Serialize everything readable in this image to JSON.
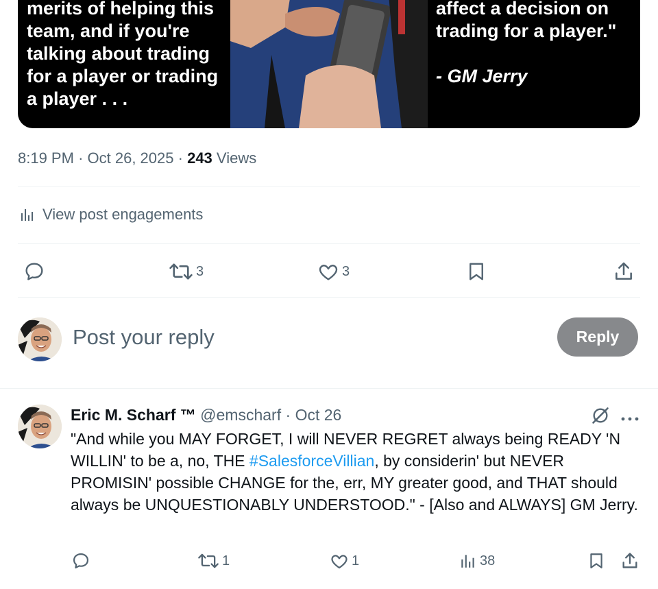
{
  "media": {
    "left_lines": [
      "merits of helping this",
      "team, and if you're",
      "talking about trading",
      "for a player or trading",
      "a player . . ."
    ],
    "right_lines": [
      "affect a decision on",
      "trading for a player.\""
    ],
    "signature": "- GM Jerry"
  },
  "meta": {
    "time": "8:19 PM",
    "date": "Oct 26, 2025",
    "views_count": "243",
    "views_label": "Views"
  },
  "engagements_label": "View post engagements",
  "actions": {
    "retweets": "3",
    "likes": "3"
  },
  "composer": {
    "placeholder": "Post your reply",
    "reply_button": "Reply"
  },
  "reply": {
    "name": "Eric M. Scharf ™",
    "handle": "@emscharf",
    "date": "Oct 26",
    "text_before": "\"And while you MAY FORGET, I will NEVER REGRET always being READY 'N WILLIN' to be a, no, THE ",
    "hashtag": "#SalesforceVillian",
    "text_after": ", by considerin' but NEVER PROMISIN' possible CHANGE for the, err, MY greater good, and THAT should always be UNQUESTIONABLY UNDERSTOOD.\" - [Also and ALWAYS] GM Jerry.",
    "retweets": "1",
    "likes": "1",
    "views": "38"
  },
  "colors": {
    "text_primary": "#0f1419",
    "text_secondary": "#536471",
    "link": "#1d9bf0",
    "reply_button_disabled": "#87898c",
    "divider": "#eff3f4"
  }
}
